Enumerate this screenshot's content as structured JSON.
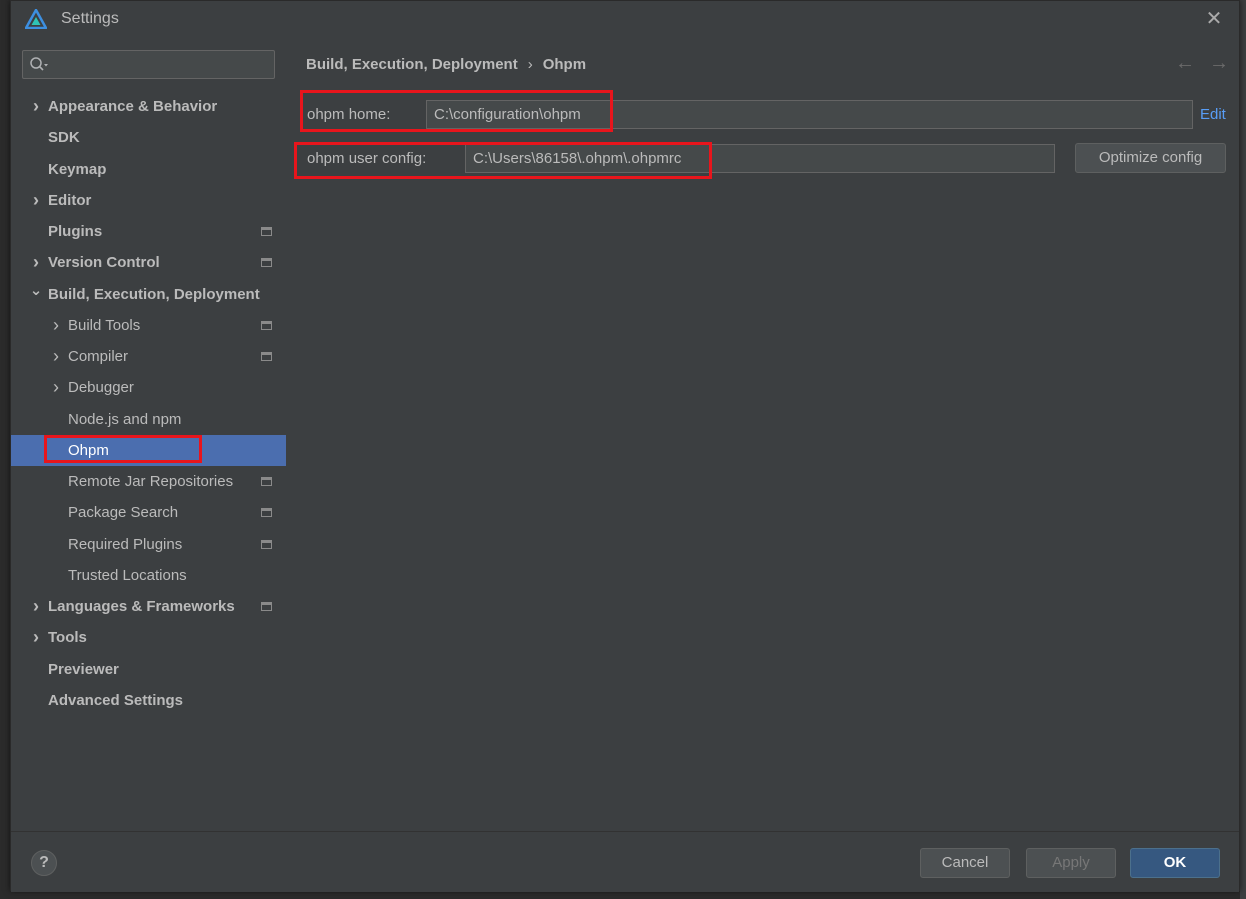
{
  "window": {
    "title": "Settings",
    "close_glyph": "✕"
  },
  "sidebar": {
    "search": {
      "value": "",
      "placeholder": ""
    },
    "items": [
      {
        "label": "Appearance & Behavior",
        "bold": true,
        "expandable": true,
        "expanded": false,
        "level": 0,
        "badge": false
      },
      {
        "label": "SDK",
        "bold": true,
        "expandable": false,
        "level": 0,
        "badge": false
      },
      {
        "label": "Keymap",
        "bold": true,
        "expandable": false,
        "level": 0,
        "badge": false
      },
      {
        "label": "Editor",
        "bold": true,
        "expandable": true,
        "expanded": false,
        "level": 0,
        "badge": false
      },
      {
        "label": "Plugins",
        "bold": true,
        "expandable": false,
        "level": 0,
        "badge": true
      },
      {
        "label": "Version Control",
        "bold": true,
        "expandable": true,
        "expanded": false,
        "level": 0,
        "badge": true
      },
      {
        "label": "Build, Execution, Deployment",
        "bold": true,
        "expandable": true,
        "expanded": true,
        "level": 0,
        "badge": false
      },
      {
        "label": "Build Tools",
        "bold": false,
        "expandable": true,
        "expanded": false,
        "level": 1,
        "badge": true
      },
      {
        "label": "Compiler",
        "bold": false,
        "expandable": true,
        "expanded": false,
        "level": 1,
        "badge": true
      },
      {
        "label": "Debugger",
        "bold": false,
        "expandable": true,
        "expanded": false,
        "level": 1,
        "badge": false
      },
      {
        "label": "Node.js and npm",
        "bold": false,
        "expandable": false,
        "level": 1,
        "badge": false
      },
      {
        "label": "Ohpm",
        "bold": false,
        "expandable": false,
        "level": 1,
        "badge": false,
        "selected": true
      },
      {
        "label": "Remote Jar Repositories",
        "bold": false,
        "expandable": false,
        "level": 1,
        "badge": true
      },
      {
        "label": "Package Search",
        "bold": false,
        "expandable": false,
        "level": 1,
        "badge": true
      },
      {
        "label": "Required Plugins",
        "bold": false,
        "expandable": false,
        "level": 1,
        "badge": true
      },
      {
        "label": "Trusted Locations",
        "bold": false,
        "expandable": false,
        "level": 1,
        "badge": false
      },
      {
        "label": "Languages & Frameworks",
        "bold": true,
        "expandable": true,
        "expanded": false,
        "level": 0,
        "badge": true
      },
      {
        "label": "Tools",
        "bold": true,
        "expandable": true,
        "expanded": false,
        "level": 0,
        "badge": false
      },
      {
        "label": "Previewer",
        "bold": true,
        "expandable": false,
        "level": 0,
        "badge": false
      },
      {
        "label": "Advanced Settings",
        "bold": true,
        "expandable": false,
        "level": 0,
        "badge": false
      }
    ]
  },
  "content": {
    "breadcrumb": {
      "parent": "Build, Execution, Deployment",
      "separator": "›",
      "current": "Ohpm"
    },
    "nav": {
      "back": "←",
      "forward": "→"
    },
    "ohpm_home": {
      "label": "ohpm home:",
      "value": "C:\\configuration\\ohpm",
      "action": "Edit"
    },
    "ohpm_user_config": {
      "label": "ohpm user config:",
      "value": "C:\\Users\\86158\\.ohpm\\.ohpmrc",
      "action": "Optimize config"
    }
  },
  "footer": {
    "help": "?",
    "cancel": "Cancel",
    "apply": "Apply",
    "ok": "OK"
  },
  "colors": {
    "background": "#3c3f41",
    "selection": "#4b6eaf",
    "highlight": "#e8151c",
    "link": "#589df6",
    "primary_button": "#365880"
  }
}
